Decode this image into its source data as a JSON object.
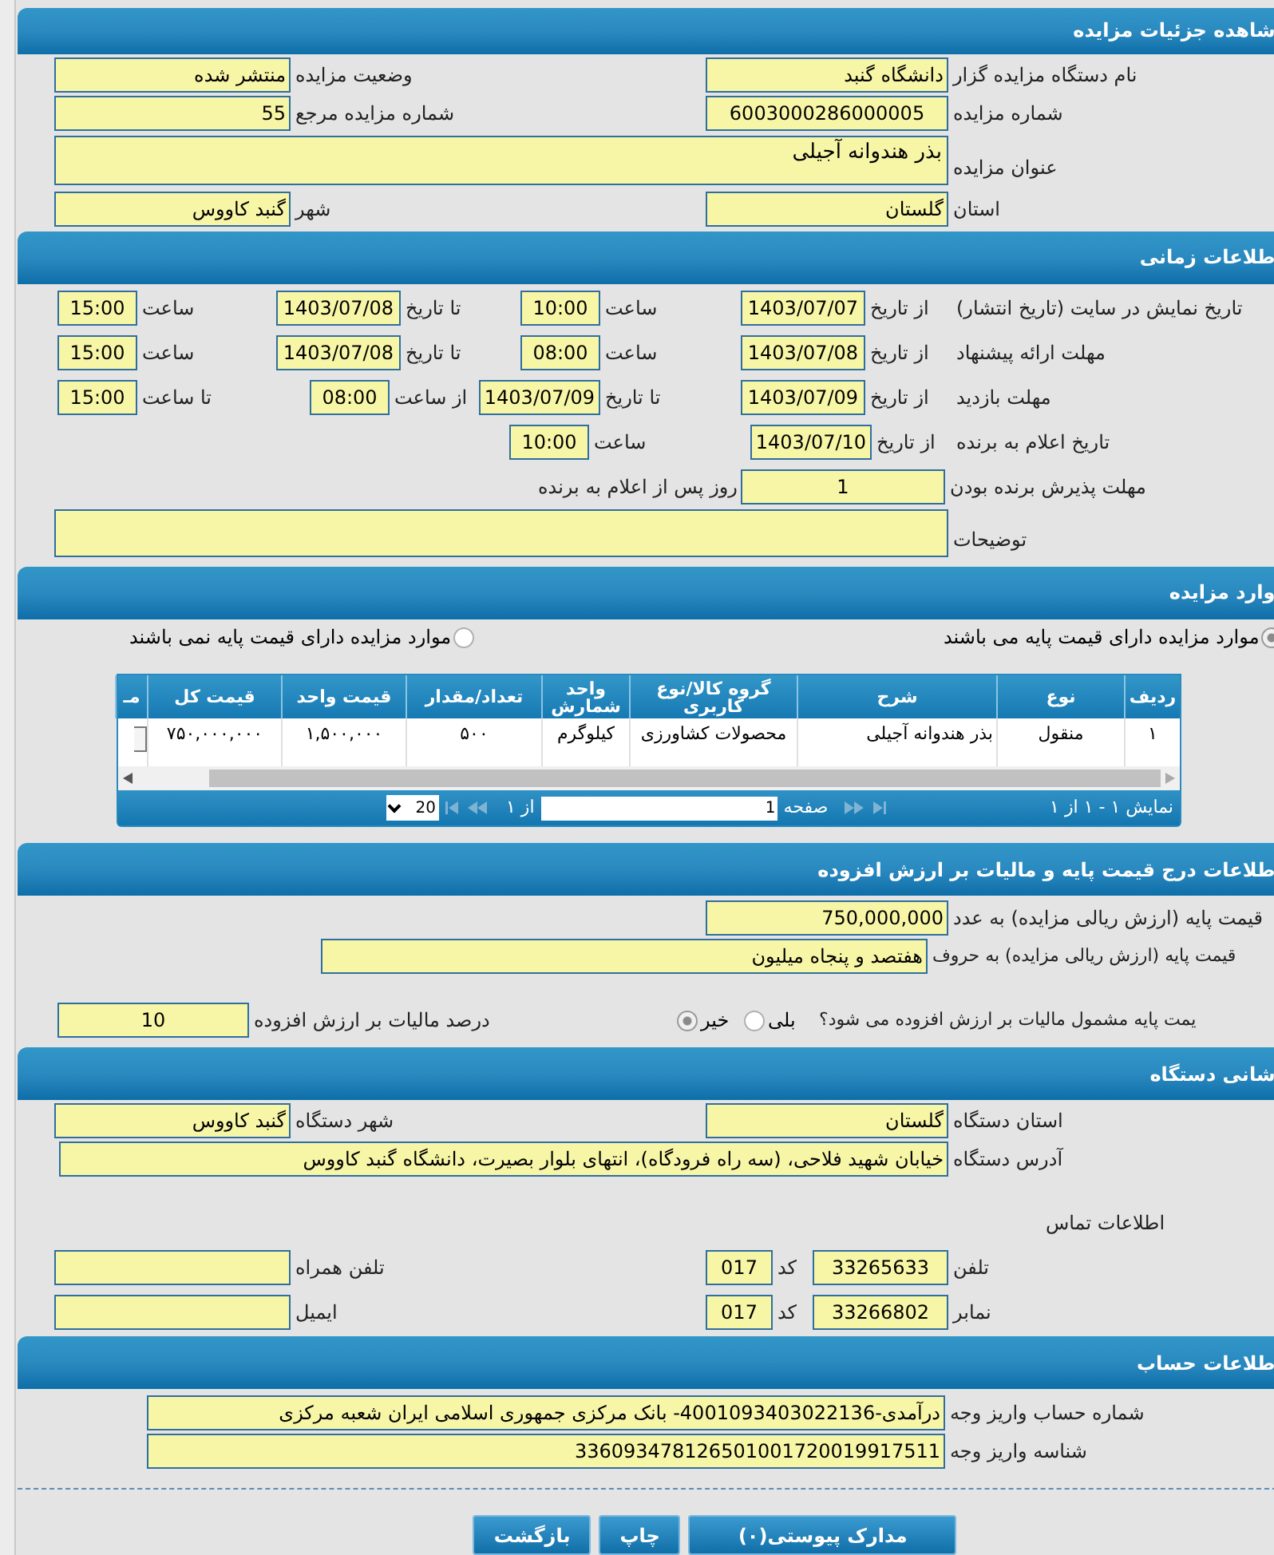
{
  "details": {
    "title": "شاهده جزئیات مزایده",
    "fields": [
      {
        "label": "نام دستگاه مزایده گزار",
        "value": "دانشگاه گنبد"
      },
      {
        "label": "وضعیت مزایده",
        "value": "منتشر شده"
      },
      {
        "label": "شماره مزایده",
        "value": "6003000286000005"
      },
      {
        "label": "شماره مزایده مرجع",
        "value": "55"
      },
      {
        "label": "عنوان مزایده",
        "value": "بذر هندوانه آجیلی"
      },
      {
        "label": "استان",
        "value": "گلستان"
      },
      {
        "label": "شهر",
        "value": "گنبد کاووس"
      }
    ]
  },
  "timing": {
    "title": "طلاعات زمانی",
    "rows": [
      {
        "kind": "range",
        "label": "تاریخ نمایش در سایت (تاریخ انتشار)",
        "cells": [
          {
            "label": "از تاریخ",
            "value": "1403/07/07"
          },
          {
            "label": "ساعت",
            "value": "10:00"
          },
          {
            "label": "تا تاریخ",
            "value": "1403/07/08"
          },
          {
            "label": "ساعت",
            "value": "15:00"
          }
        ]
      },
      {
        "kind": "range",
        "label": "مهلت ارائه پیشنهاد",
        "cells": [
          {
            "label": "از تاریخ",
            "value": "1403/07/08"
          },
          {
            "label": "ساعت",
            "value": "08:00"
          },
          {
            "label": "تا تاریخ",
            "value": "1403/07/08"
          },
          {
            "label": "ساعت",
            "value": "15:00"
          }
        ]
      },
      {
        "kind": "visit",
        "label": "مهلت بازدید",
        "cells": [
          {
            "label": "از تاریخ",
            "value": "1403/07/09"
          },
          {
            "label": "تا تاریخ",
            "value": "1403/07/09"
          },
          {
            "label": "از ساعت",
            "value": "08:00"
          },
          {
            "label": "تا ساعت",
            "value": "15:00"
          }
        ]
      },
      {
        "kind": "announce",
        "label": "تاریخ اعلام به برنده",
        "cells": [
          {
            "label": "از تاریخ",
            "value": "1403/07/10"
          },
          {
            "label": "ساعت",
            "value": "10:00"
          }
        ]
      }
    ],
    "acceptance": {
      "label": "مهلت پذیرش برنده بودن",
      "value": "1",
      "suffix": "روز پس از اعلام به برنده"
    },
    "notes_label": "توضیحات"
  },
  "items": {
    "title": "وارد مزایده",
    "options": [
      {
        "label": "موارد مزایده دارای قیمت پایه می باشند",
        "selected": true
      },
      {
        "label": "موارد مزایده دارای قیمت پایه نمی باشند",
        "selected": false
      }
    ],
    "table": {
      "columns": [
        "ردیف",
        "نوع",
        "شرح",
        "گروه کالا/نوع کاربری",
        "واحد شمارش",
        "تعداد/مقدار",
        "قیمت واحد",
        "قیمت کل",
        "مـ"
      ],
      "rows": [
        {
          "cells": [
            "۱",
            "منقول",
            "بذر هندوانه آجیلی",
            "محصولات کشاورزی",
            "کیلوگرم",
            "۵۰۰",
            "۱,۵۰۰,۰۰۰",
            "۷۵۰,۰۰۰,۰۰۰"
          ]
        }
      ]
    },
    "pager": {
      "summary": "نمایش ۱ - ۱ از ۱",
      "page_label": "صفحه",
      "page": "1",
      "of": "از ۱",
      "page_size": "20"
    }
  },
  "price": {
    "title": "طلاعات درج قیمت پایه و مالیات بر ارزش افزوده",
    "amount": {
      "label": "قیمت پایه (ارزش ریالی مزایده) به عدد",
      "value": "750,000,000"
    },
    "words": {
      "label": "قیمت پایه (ارزش ریالی مزایده) به حروف",
      "value": "هفتصد و پنجاه میلیون"
    },
    "tax_question": "یمت پایه مشمول مالیات بر ارزش افزوده می شود؟",
    "tax_options": [
      {
        "label": "بلی",
        "selected": false
      },
      {
        "label": "خیر",
        "selected": true
      }
    ],
    "tax_percent": {
      "label": "درصد مالیات بر ارزش افزوده",
      "value": "10"
    }
  },
  "address": {
    "title": "شانی دستگاه",
    "fields": [
      {
        "label": "استان دستگاه",
        "value": "گلستان"
      },
      {
        "label": "شهر دستگاه",
        "value": "گنبد کاووس"
      },
      {
        "label": "آدرس دستگاه",
        "value": "خیابان شهید فلاحی، (سه راه فرودگاه)، انتهای بلوار بصیرت، دانشگاه گنبد کاووس"
      }
    ],
    "contact_title": "اطلاعات تماس",
    "contacts": [
      {
        "label": "تلفن",
        "value": "33265633",
        "code_label": "کد",
        "code": "017",
        "other_label": "تلفن همراه"
      },
      {
        "label": "نمابر",
        "value": "33266802",
        "code_label": "کد",
        "code": "017",
        "other_label": "ایمیل"
      }
    ]
  },
  "account": {
    "title": "طلاعات حساب",
    "fields": [
      {
        "label": "شماره حساب واریز وجه",
        "value": "درآمدی-4001093403022136- بانک مرکزی جمهوری اسلامی ایران شعبه مرکزی"
      },
      {
        "label": "شناسه واریز وجه",
        "value": "336093478126501001720019917511"
      }
    ]
  },
  "buttons": [
    "مدارک پیوستی(۰)",
    "چاپ",
    "بازگشت"
  ]
}
